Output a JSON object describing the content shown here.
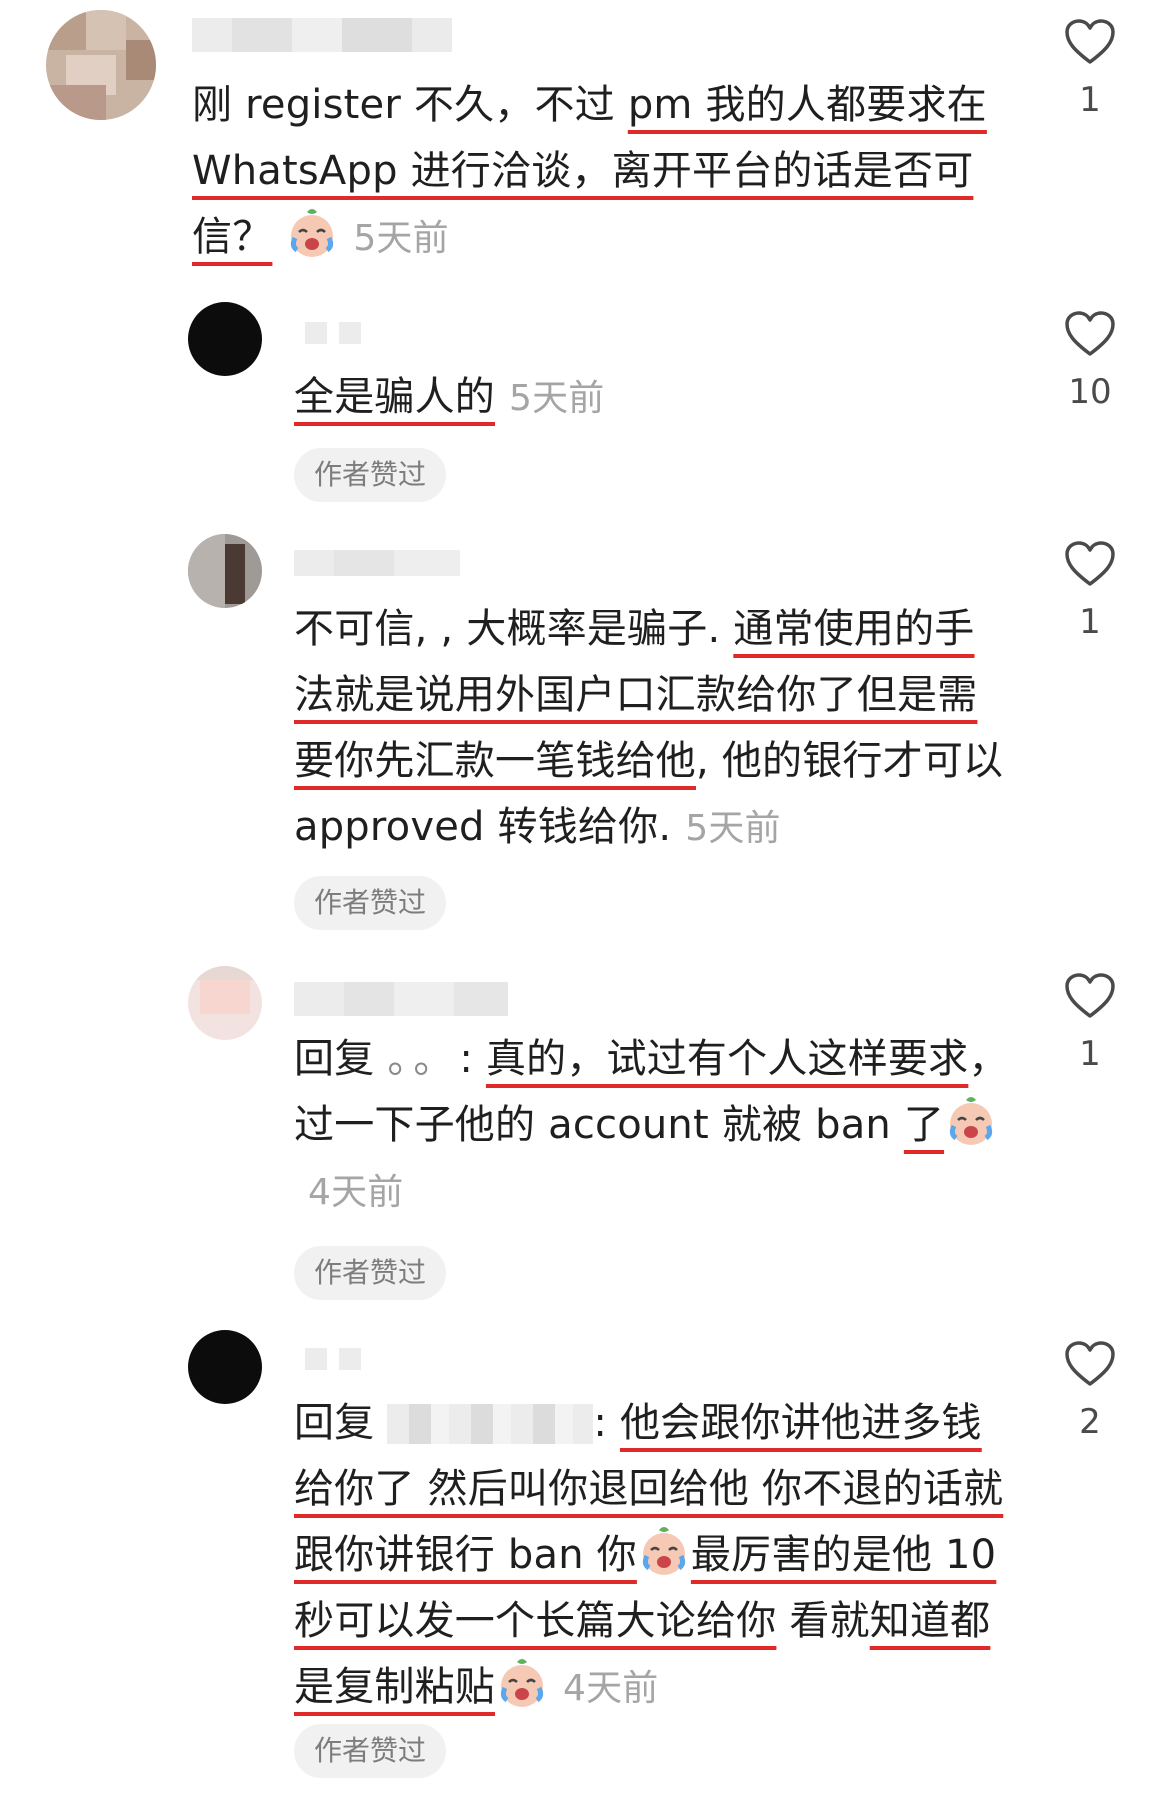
{
  "comments": [
    {
      "id": "c1",
      "user_label": "",
      "segments": [
        {
          "t": "刚 register 不久，不过 ",
          "u": false
        },
        {
          "t": "pm 我的人都要求在",
          "u": true
        },
        {
          "t": "WhatsApp 进行洽谈，离开平台的话是否可",
          "u": true
        },
        {
          "t": "信？",
          "u": true
        }
      ],
      "emoji": "crying-face-emoji",
      "time": "5天前",
      "likes": "1",
      "author_liked": ""
    },
    {
      "id": "c2",
      "segments": [
        {
          "t": "全是骗人的",
          "u": true
        }
      ],
      "time": "5天前",
      "likes": "10",
      "author_liked": "作者赞过"
    },
    {
      "id": "c3",
      "segments": [
        {
          "t": "不可信, , 大概率是骗子. ",
          "u": false
        },
        {
          "t": "通常使用的手法就是说用外国户口汇款给你了但是需要你先汇款一笔钱给他",
          "u": true
        },
        {
          "t": ", 他的银行才可以 approved 转钱给你.",
          "u": false
        }
      ],
      "time": "5天前",
      "likes": "1",
      "author_liked": "作者赞过"
    },
    {
      "id": "c4",
      "reply_prefix": "回复",
      "reply_to": "。。",
      "segments": [
        {
          "t": "真的，试过有个人这样要求",
          "u": true
        },
        {
          "t": "，过一下子他的 account 就被 ban ",
          "u": false
        },
        {
          "t": "了",
          "u": true
        }
      ],
      "emoji": "crying-face-emoji",
      "time": "4天前",
      "likes": "1",
      "author_liked": "作者赞过"
    },
    {
      "id": "c5",
      "reply_prefix": "回复",
      "reply_to": "",
      "segments": [
        {
          "t": "他会跟你讲他进多钱给你了 然后叫你退回给他 你不退的话就跟你讲银行 ban 你",
          "u": true
        }
      ],
      "mid_emoji": "crying-face-emoji",
      "segments2": [
        {
          "t": "最厉害的是他 10 秒可以发一个长篇大论给你",
          "u": true
        },
        {
          "t": " 看就",
          "u": false
        },
        {
          "t": "知道都是复制粘贴",
          "u": true
        }
      ],
      "emoji": "crying-face-emoji",
      "time": "4天前",
      "likes": "2",
      "author_liked": "作者赞过"
    }
  ],
  "colors": {
    "underline": "#e02a2a",
    "time": "#a5a5a5",
    "pill_bg": "#f1f1f1",
    "text": "#1f1f1f"
  },
  "icons": {
    "like": "heart-outline-icon"
  }
}
